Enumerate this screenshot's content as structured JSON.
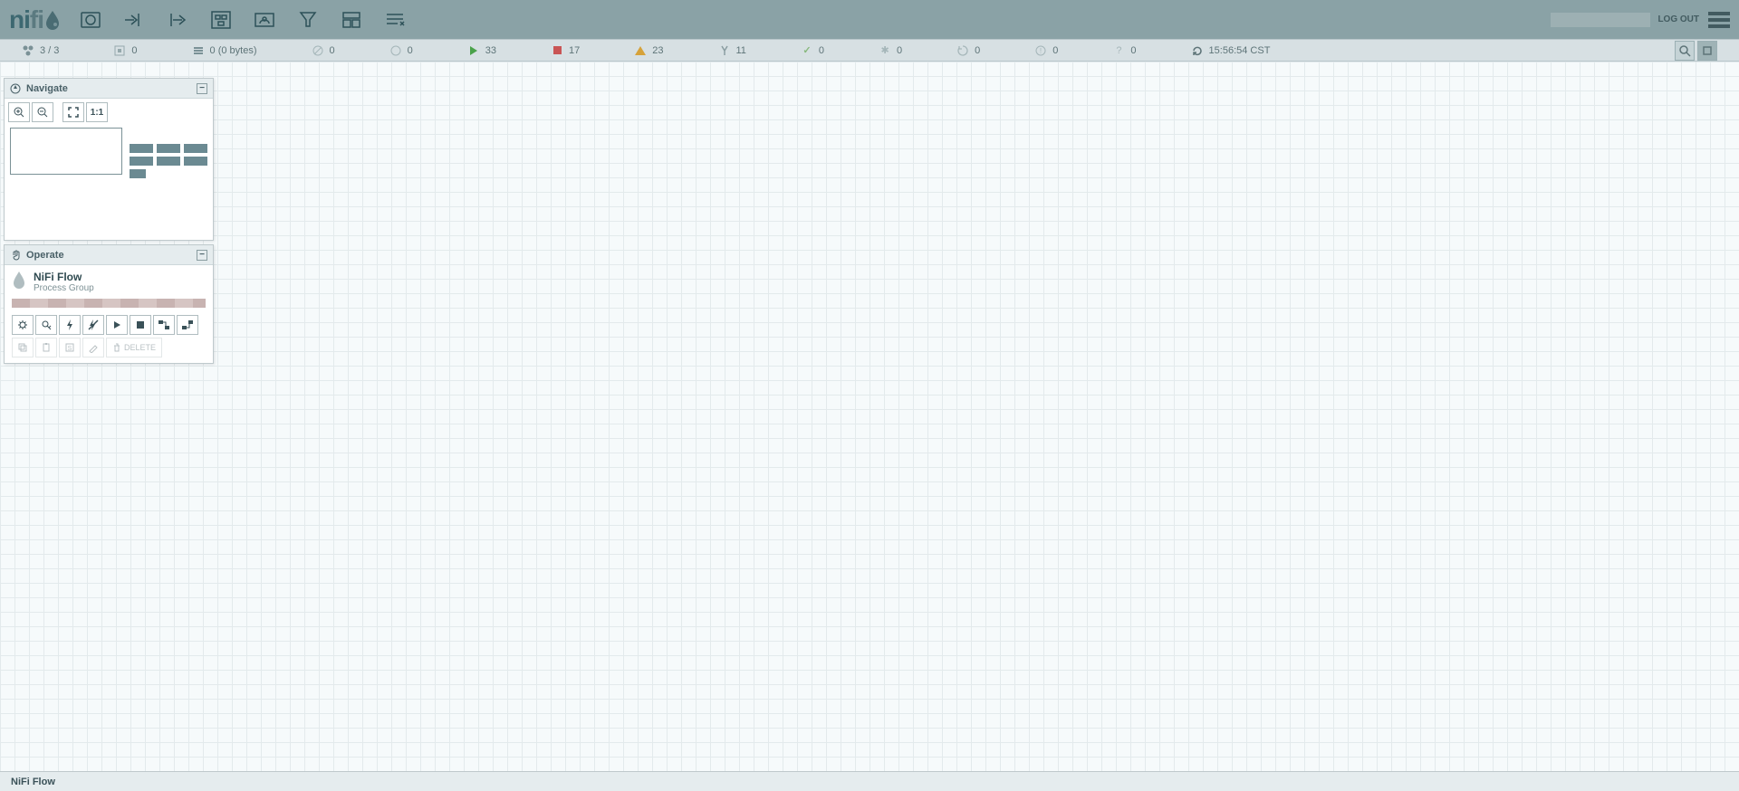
{
  "header": {
    "logout_label": "LOG OUT"
  },
  "status": {
    "nodes": "3 / 3",
    "threads": "0",
    "queued": "0 (0 bytes)",
    "transmitting_disabled": "0",
    "transmitting_inactive": "0",
    "running": "33",
    "stopped": "17",
    "invalid": "23",
    "disabled": "11",
    "uptodate": "0",
    "locally_mod": "0",
    "stale": "0",
    "sync_fail": "0",
    "unknown": "0",
    "refresh_time": "15:56:54 CST"
  },
  "navigate": {
    "title": "Navigate"
  },
  "operate": {
    "title": "Operate",
    "flow_name": "NiFi Flow",
    "flow_type": "Process Group",
    "delete_label": "DELETE"
  },
  "footer": {
    "breadcrumb": "NiFi Flow"
  }
}
